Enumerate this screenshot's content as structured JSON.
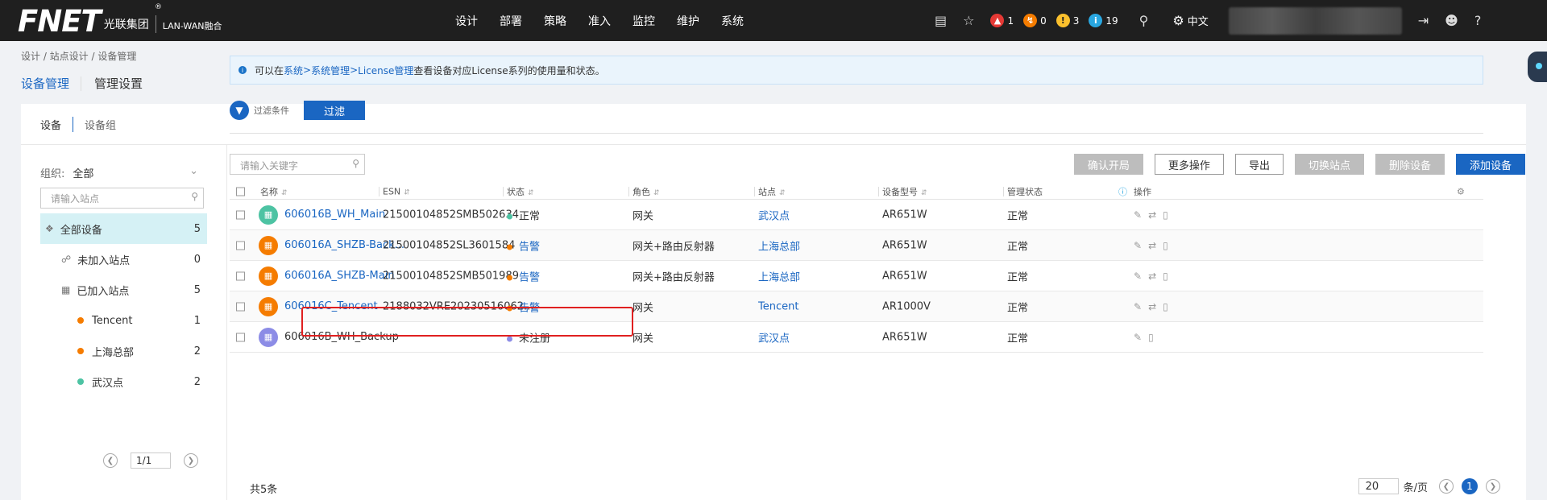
{
  "brand": {
    "logo": "FNET",
    "registered": "®",
    "company": "光联集团",
    "product": "LAN-WAN融合"
  },
  "nav": [
    "设计",
    "部署",
    "策略",
    "准入",
    "监控",
    "维护",
    "系统"
  ],
  "alarms": [
    {
      "icon": "critical-alarm-icon",
      "count": "1",
      "color": "#e53935"
    },
    {
      "icon": "major-alarm-icon",
      "count": "0",
      "color": "#f57c00"
    },
    {
      "icon": "minor-alarm-icon",
      "count": "3",
      "color": "#fbc02d"
    },
    {
      "icon": "info-alarm-icon",
      "count": "19",
      "color": "#29a7e1"
    }
  ],
  "language": "中文",
  "breadcrumb": "设计 / 站点设计 / 设备管理",
  "page_tabs": [
    "设备管理",
    "管理设置"
  ],
  "sub_tabs": [
    "设备",
    "设备组"
  ],
  "left": {
    "org_label": "组织:",
    "org_value": "全部",
    "site_search_placeholder": "请输入站点",
    "tree": [
      {
        "label": "全部设备",
        "count": "5"
      },
      {
        "label": "未加入站点",
        "count": "0"
      },
      {
        "label": "已加入站点",
        "count": "5"
      },
      {
        "label": "Tencent",
        "count": "1",
        "color": "#f57c00"
      },
      {
        "label": "上海总部",
        "count": "2",
        "color": "#f57c00"
      },
      {
        "label": "武汉点",
        "count": "2",
        "color": "#4dc3a3"
      }
    ],
    "page": "1/1"
  },
  "info": {
    "prefix": "可以在",
    "link1": "系统",
    "sep1": " > ",
    "link2": "系统管理",
    "sep2": " > ",
    "link3": "License管理",
    "suffix": "查看设备对应License系列的使用量和状态。"
  },
  "filter": {
    "label": "过滤条件",
    "button": "过滤"
  },
  "keyword_placeholder": "请输入关键字",
  "actions": [
    "确认开局",
    "更多操作",
    "导出",
    "切换站点",
    "删除设备",
    "添加设备"
  ],
  "table": {
    "headers": [
      "名称",
      "ESN",
      "状态",
      "角色",
      "站点",
      "设备型号",
      "管理状态",
      "操作"
    ],
    "rows": [
      {
        "name": "606016B_WH_Main",
        "esn": "21500104852SMB502634",
        "status": "正常",
        "status_color": "#4dc3a3",
        "role": "网关",
        "site": "武汉点",
        "model": "AR651W",
        "mgmt": "正常",
        "icon_color": "#4dc3a3"
      },
      {
        "name": "606016A_SHZB-Back...",
        "esn": "21500104852SL3601584",
        "status": "告警",
        "status_color": "#f57c00",
        "role": "网关+路由反射器",
        "site": "上海总部",
        "model": "AR651W",
        "mgmt": "正常",
        "icon_color": "#f57c00"
      },
      {
        "name": "606016A_SHZB-Main",
        "esn": "21500104852SMB501989",
        "status": "告警",
        "status_color": "#f57c00",
        "role": "网关+路由反射器",
        "site": "上海总部",
        "model": "AR651W",
        "mgmt": "正常",
        "icon_color": "#f57c00"
      },
      {
        "name": "606016C_Tencent",
        "esn": "2188032VRE20230516062...",
        "status": "告警",
        "status_color": "#f57c00",
        "role": "网关",
        "site": "Tencent",
        "model": "AR1000V",
        "mgmt": "正常",
        "icon_color": "#f57c00"
      },
      {
        "name": "606016B_WH_Backup",
        "esn": "",
        "status": "未注册",
        "status_color": "#8c8ce6",
        "role": "网关",
        "site": "武汉点",
        "model": "AR651W",
        "mgmt": "正常",
        "icon_color": "#8c8ce6"
      }
    ]
  },
  "footer": {
    "total": "共5条",
    "page_size": "20",
    "per_page": "条/页",
    "current_page": "1"
  }
}
